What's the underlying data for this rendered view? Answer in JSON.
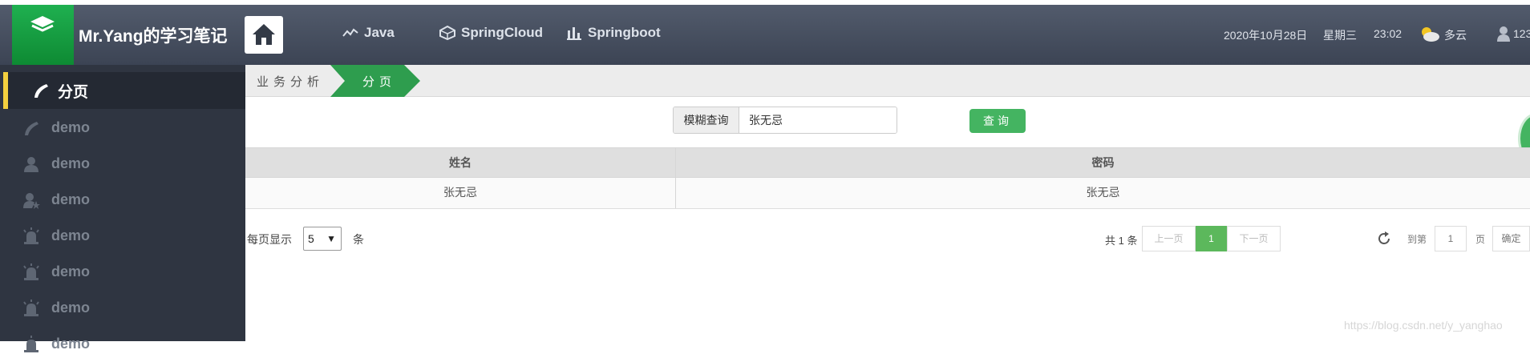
{
  "header": {
    "title": "Mr.Yang的学习笔记",
    "nav": [
      {
        "label": "Java",
        "icon": "line-chart-icon"
      },
      {
        "label": "SpringCloud",
        "icon": "cube-icon"
      },
      {
        "label": "Springboot",
        "icon": "bar-chart-icon"
      }
    ],
    "date": "2020年10月28日",
    "weekday": "星期三",
    "time": "23:02",
    "weather": "多云",
    "user": "123"
  },
  "sidebar": {
    "active": {
      "label": "分页",
      "icon": "phone-icon"
    },
    "items": [
      {
        "label": "demo",
        "icon": "phone-icon"
      },
      {
        "label": "demo",
        "icon": "user-icon"
      },
      {
        "label": "demo",
        "icon": "user-star-icon"
      },
      {
        "label": "demo",
        "icon": "alarm-icon"
      },
      {
        "label": "demo",
        "icon": "alarm-icon"
      },
      {
        "label": "demo",
        "icon": "alarm-icon"
      },
      {
        "label": "demo",
        "icon": "alarm-icon"
      }
    ]
  },
  "breadcrumb": {
    "parent": "业务分析",
    "current": "分页"
  },
  "search": {
    "addon": "模糊查询",
    "value": "张无忌",
    "button": "查询"
  },
  "table": {
    "headers": [
      "姓名",
      "密码"
    ],
    "rows": [
      [
        "张无忌",
        "张无忌"
      ]
    ]
  },
  "pagination": {
    "per_page_label": "每页显示",
    "per_page_value": "5",
    "per_page_unit": "条",
    "total": "共 1 条",
    "prev": "上一页",
    "current": "1",
    "next": "下一页",
    "goto_label": "到第",
    "goto_value": "1",
    "page_unit": "页",
    "confirm": "确定"
  },
  "watermark": "https://blog.csdn.net/y_yanghao",
  "colors": {
    "header": "#474f5f",
    "sidebar": "#2f3541",
    "accent": "#44b461",
    "active_bar": "#f4d03f"
  }
}
